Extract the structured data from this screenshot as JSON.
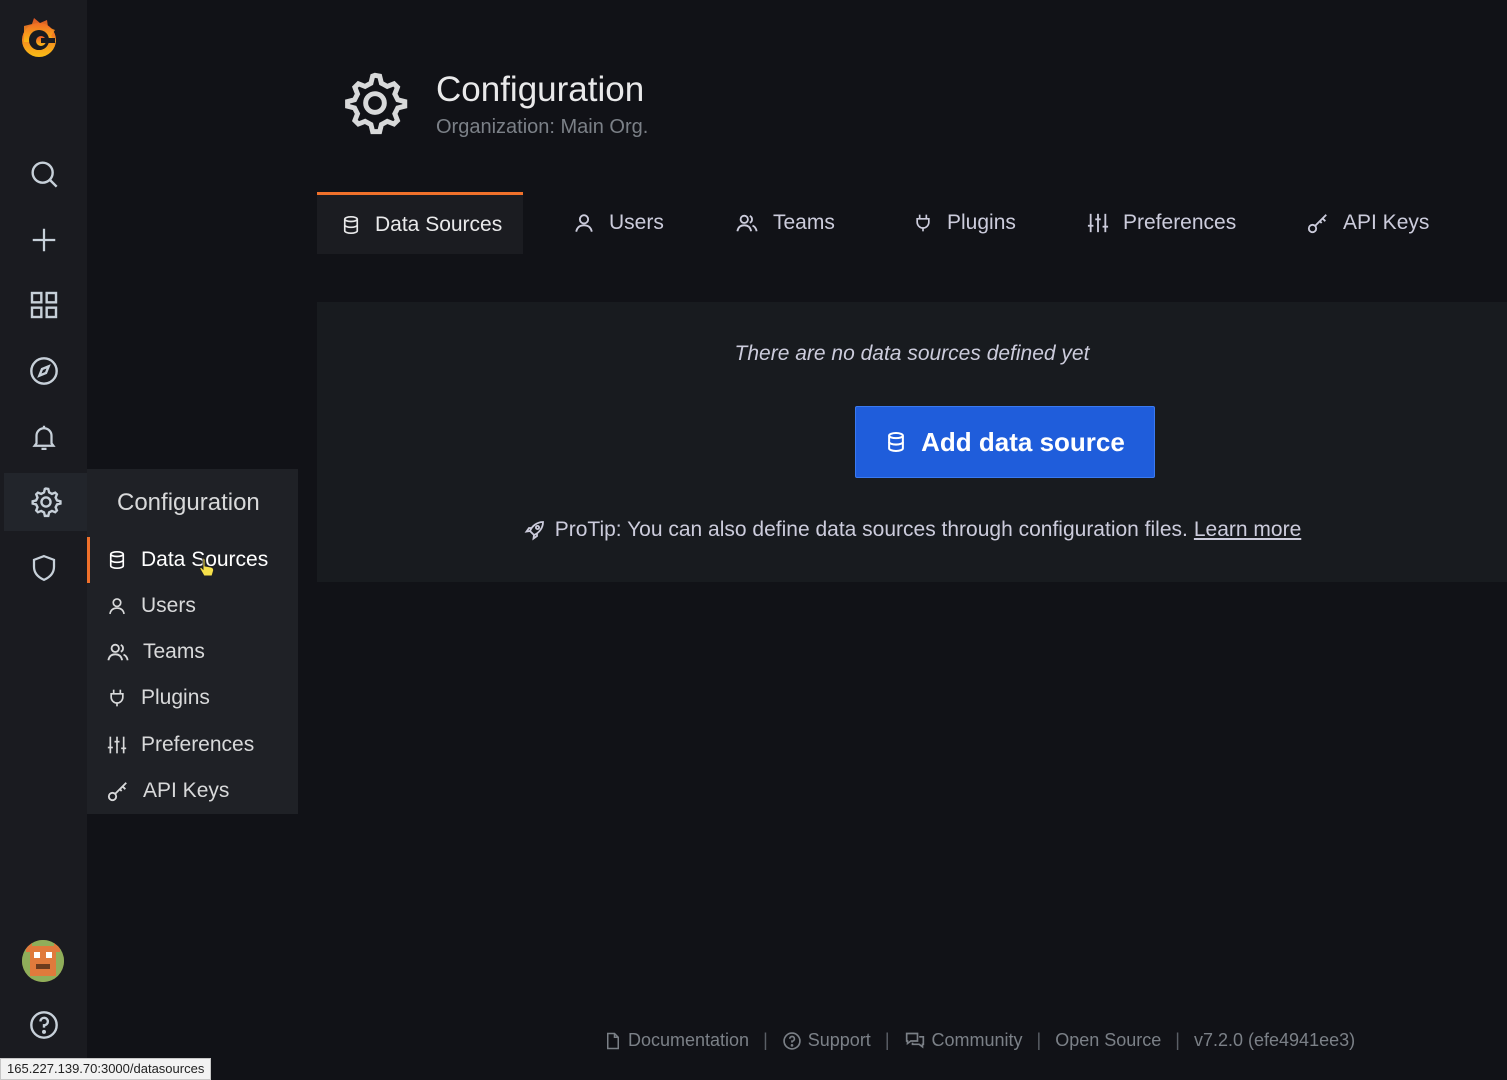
{
  "header": {
    "title": "Configuration",
    "subtitle": "Organization: Main Org."
  },
  "tabs": [
    {
      "label": "Data Sources",
      "icon": "database-icon",
      "active": true
    },
    {
      "label": "Users",
      "icon": "user-icon",
      "active": false
    },
    {
      "label": "Teams",
      "icon": "users-icon",
      "active": false
    },
    {
      "label": "Plugins",
      "icon": "plug-icon",
      "active": false
    },
    {
      "label": "Preferences",
      "icon": "sliders-icon",
      "active": false
    },
    {
      "label": "API Keys",
      "icon": "key-icon",
      "active": false
    }
  ],
  "empty_state": {
    "message": "There are no data sources defined yet",
    "button_label": "Add data source",
    "protip": "ProTip: You can also define data sources through configuration files.",
    "learn_more": "Learn more"
  },
  "flyout": {
    "title": "Configuration",
    "items": [
      {
        "label": "Data Sources",
        "icon": "database-icon",
        "active": true
      },
      {
        "label": "Users",
        "icon": "user-icon"
      },
      {
        "label": "Teams",
        "icon": "users-icon"
      },
      {
        "label": "Plugins",
        "icon": "plug-icon"
      },
      {
        "label": "Preferences",
        "icon": "sliders-icon"
      },
      {
        "label": "API Keys",
        "icon": "key-icon"
      }
    ]
  },
  "sidebar": {
    "icons": [
      "grafana-logo",
      "search-icon",
      "plus-icon",
      "dashboards-icon",
      "explore-icon",
      "alert-bell-icon",
      "gear-icon",
      "shield-icon",
      "avatar",
      "help-icon"
    ]
  },
  "footer": {
    "documentation": "Documentation",
    "support": "Support",
    "community": "Community",
    "open_source": "Open Source",
    "version": "v7.2.0 (efe4941ee3)"
  },
  "status_bar": {
    "url": "165.227.139.70:3000/datasources"
  },
  "colors": {
    "accent": "#f0712b",
    "primary_button": "#1f5ddb",
    "background": "#111217"
  }
}
